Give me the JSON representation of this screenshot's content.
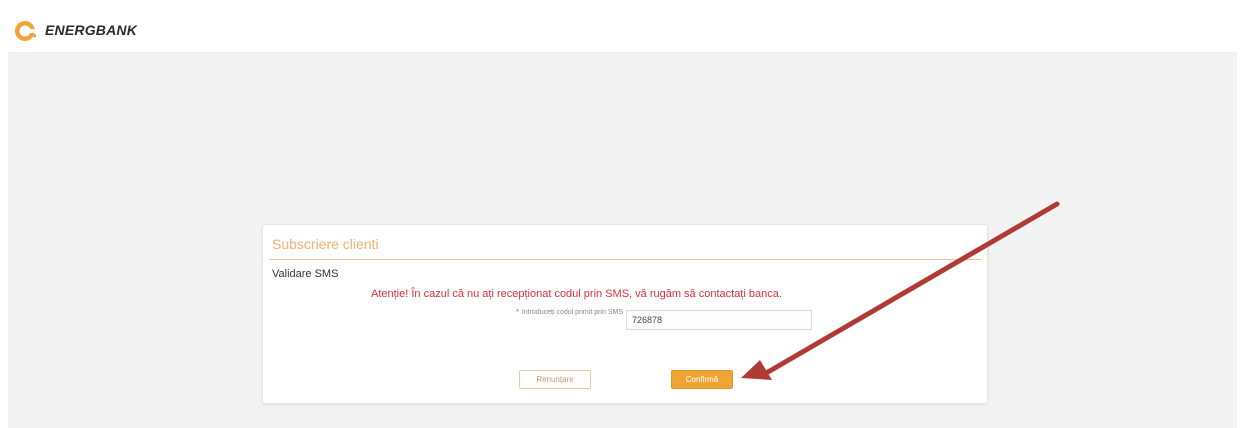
{
  "header": {
    "brand": "ENERGBANK",
    "brand_colors": {
      "logo_orange": "#f3a23a",
      "logo_green": "#8ac43f"
    }
  },
  "panel": {
    "title": "Subscriere clienti",
    "section": "Validare SMS",
    "warning": "Atenție! În cazul că nu ați recepționat codul prin SMS, vă rugăm să contactați banca.",
    "field": {
      "required_mark": "*",
      "label": "Introduceți codul primit prin SMS",
      "value": "726878"
    },
    "buttons": {
      "cancel": "Renunțare",
      "confirm": "Confirmă"
    }
  },
  "annotation": {
    "arrow_color": "#b23a34",
    "points_to": "confirm-button"
  }
}
